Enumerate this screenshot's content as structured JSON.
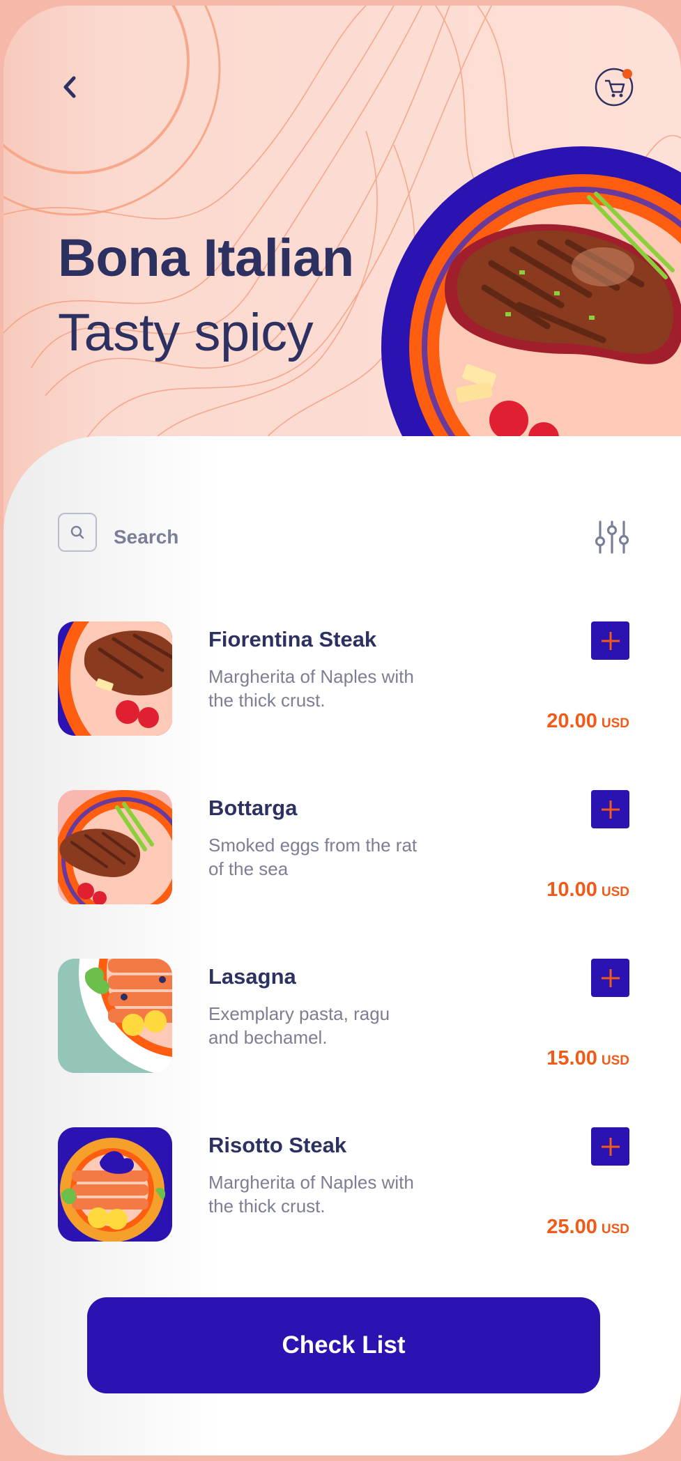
{
  "header": {
    "title": "Bona Italian",
    "subtitle": "Tasty spicy",
    "back_icon": "chevron-left-icon",
    "cart_icon": "shopping-cart-icon"
  },
  "search": {
    "placeholder": "Search",
    "icon": "search-icon"
  },
  "filter": {
    "icon": "sliders-icon"
  },
  "menu": {
    "items": [
      {
        "name": "Fiorentina Steak",
        "description": "Margherita of Naples with the thick crust.",
        "price": "20.00",
        "currency": "USD"
      },
      {
        "name": "Bottarga",
        "description": "Smoked eggs from the rat of the sea",
        "price": "10.00",
        "currency": "USD"
      },
      {
        "name": "Lasagna",
        "description": "Exemplary pasta, ragu and bechamel.",
        "price": "15.00",
        "currency": "USD"
      },
      {
        "name": "Risotto Steak",
        "description": "Margherita of Naples with the thick crust.",
        "price": "25.00",
        "currency": "USD"
      }
    ]
  },
  "footer": {
    "button_label": "Check List"
  },
  "colors": {
    "primary": "#2a13b0",
    "accent": "#f25a17",
    "text_dark": "#2d3161",
    "text_muted": "#7c7f94",
    "hero_bg": "#fde0d7"
  }
}
